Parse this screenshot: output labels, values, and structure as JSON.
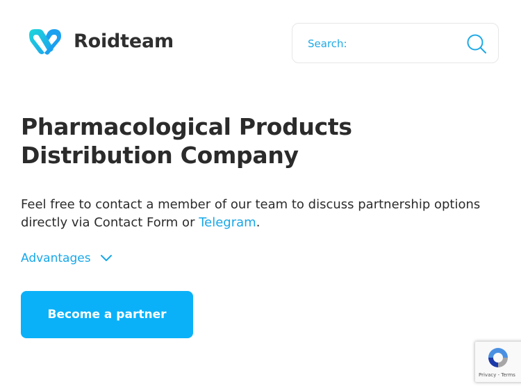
{
  "header": {
    "brand_name": "Roidteam",
    "logo_icon": "heart-link-icon",
    "search": {
      "placeholder": "Search:",
      "value": "",
      "icon": "search-icon"
    }
  },
  "hero": {
    "headline_line1": "Pharmacological Products",
    "headline_line2": "Distribution Company",
    "intro_text": "Feel free to contact a member of our team to discuss partnership options directly via Contact Form or ",
    "intro_link": "Telegram",
    "intro_end": ".",
    "advantages_label": "Advantages",
    "advantages_icon": "chevron-down-icon",
    "cta_label": "Become a partner"
  },
  "recaptcha": {
    "privacy_label": "Privacy",
    "separator": " - ",
    "terms_label": "Terms"
  },
  "colors": {
    "accent": "#17a7e8",
    "button": "#0bb1f8",
    "text": "#2b2b2b"
  }
}
